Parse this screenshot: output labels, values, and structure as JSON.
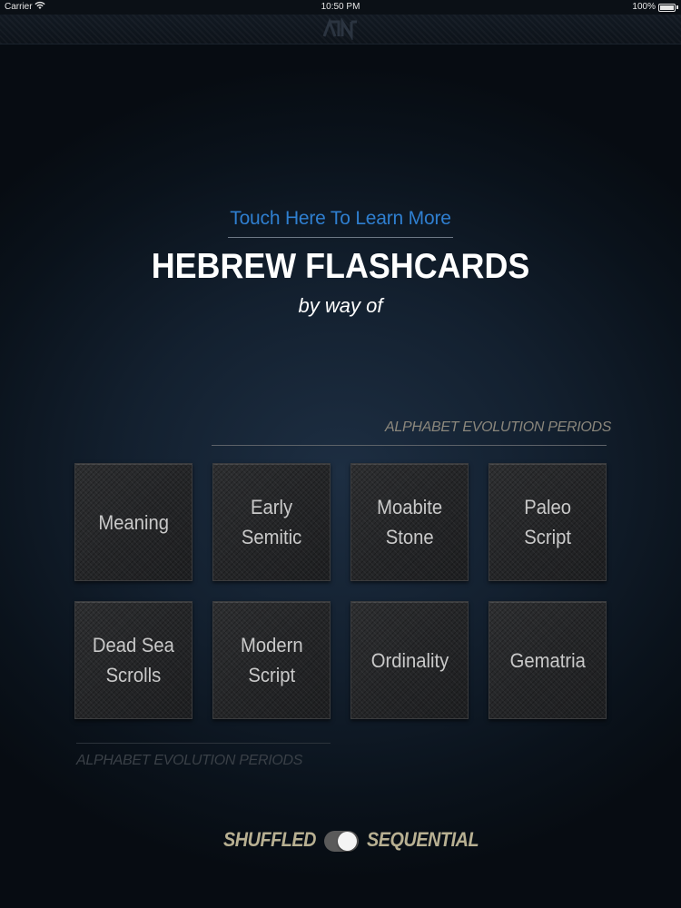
{
  "status_bar": {
    "carrier": "Carrier",
    "time": "10:50 PM",
    "battery": "100%"
  },
  "header": {
    "learn_more": "Touch Here To Learn More",
    "title": "HEBREW FLASHCARDS",
    "subtitle": "by way of"
  },
  "section": {
    "top_label": "ALPHABET EVOLUTION PERIODS",
    "bottom_label": "ALPHABET EVOLUTION PERIODS"
  },
  "cards": [
    {
      "label": "Meaning"
    },
    {
      "label": "Early\nSemitic"
    },
    {
      "label": "Moabite\nStone"
    },
    {
      "label": "Paleo\nScript"
    },
    {
      "label": "Dead Sea\nScrolls"
    },
    {
      "label": "Modern\nScript"
    },
    {
      "label": "Ordinality"
    },
    {
      "label": "Gematria"
    }
  ],
  "mode": {
    "left_label": "SHUFFLED",
    "right_label": "SEQUENTIAL",
    "toggle_on": true
  },
  "icons": {
    "wifi": "wifi-icon",
    "battery": "battery-icon",
    "logo": "app-logo-icon"
  }
}
